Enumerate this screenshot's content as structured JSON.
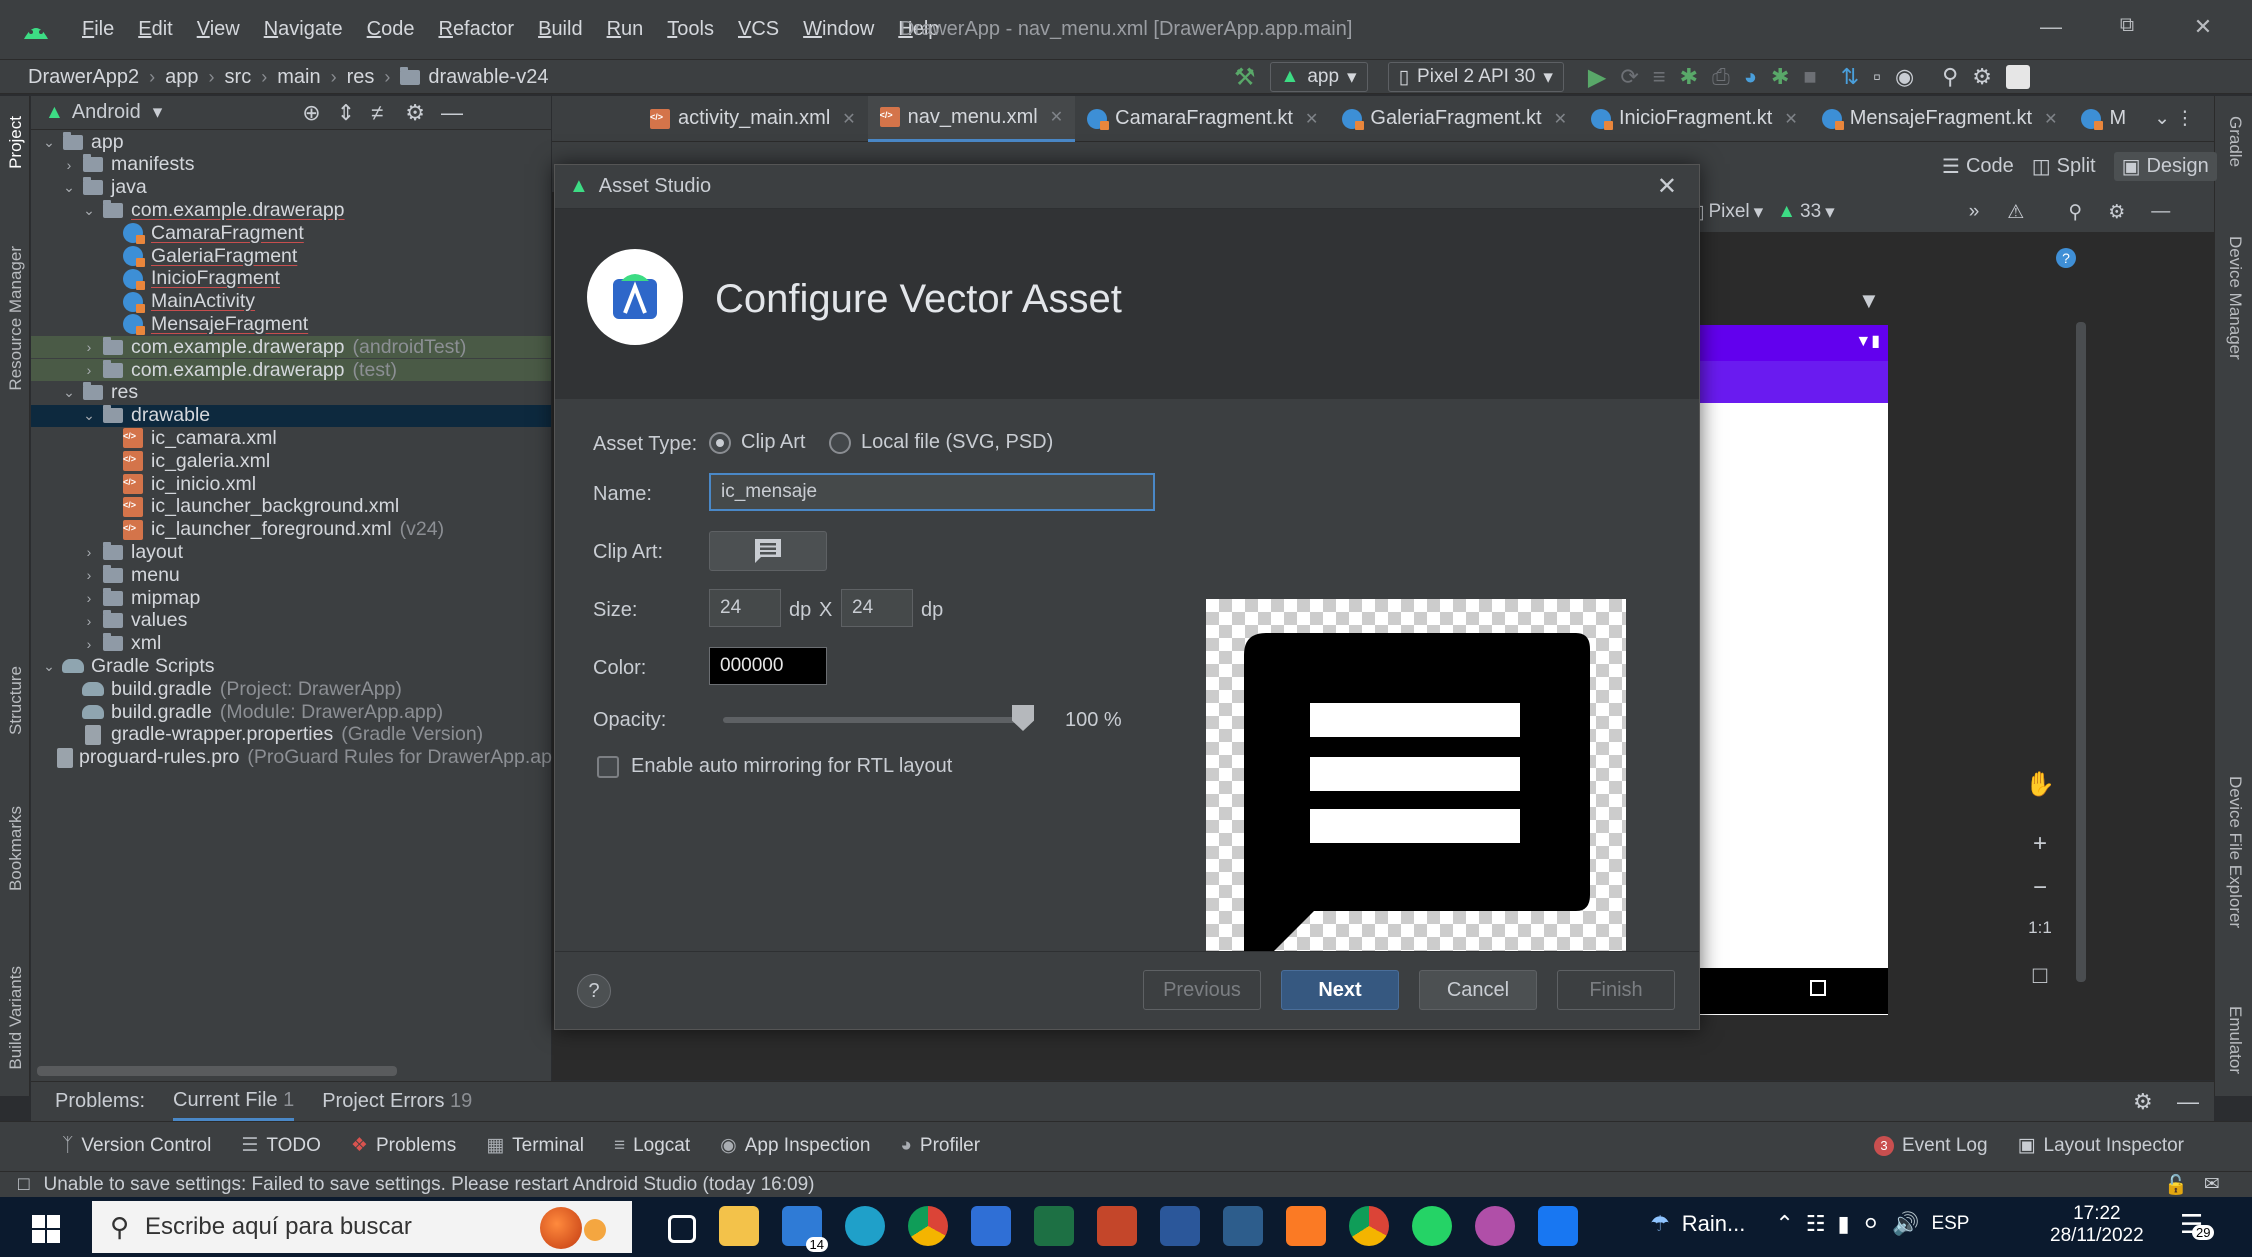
{
  "menu": [
    "File",
    "Edit",
    "View",
    "Navigate",
    "Code",
    "Refactor",
    "Build",
    "Run",
    "Tools",
    "VCS",
    "Window",
    "Help"
  ],
  "window_title": "DrawerApp - nav_menu.xml [DrawerApp.app.main]",
  "breadcrumb": [
    "DrawerApp2",
    "app",
    "src",
    "main",
    "res",
    "drawable-v24"
  ],
  "toolbar": {
    "run_config": "app",
    "device": "Pixel 2 API 30"
  },
  "project_panel": {
    "view_mode": "Android"
  },
  "tree": [
    {
      "label": "app",
      "depth": 0,
      "open": true,
      "icon": "module-icon"
    },
    {
      "label": "manifests",
      "depth": 1,
      "open": false,
      "icon": "folder-icon"
    },
    {
      "label": "java",
      "depth": 1,
      "open": true,
      "icon": "folder-icon"
    },
    {
      "label": "com.example.drawerapp",
      "depth": 2,
      "open": true,
      "icon": "package-icon",
      "link": true
    },
    {
      "label": "CamaraFragment",
      "depth": 3,
      "icon": "kotlin-icon",
      "link": true
    },
    {
      "label": "GaleriaFragment",
      "depth": 3,
      "icon": "kotlin-icon",
      "link": true
    },
    {
      "label": "InicioFragment",
      "depth": 3,
      "icon": "kotlin-icon",
      "link": true
    },
    {
      "label": "MainActivity",
      "depth": 3,
      "icon": "kotlin-icon",
      "link": true
    },
    {
      "label": "MensajeFragment",
      "depth": 3,
      "icon": "kotlin-icon",
      "link": true
    },
    {
      "label": "com.example.drawerapp",
      "hint": "(androidTest)",
      "depth": 2,
      "open": false,
      "icon": "package-icon",
      "shade": true
    },
    {
      "label": "com.example.drawerapp",
      "hint": "(test)",
      "depth": 2,
      "open": false,
      "icon": "package-icon",
      "shade": true
    },
    {
      "label": "res",
      "depth": 1,
      "open": true,
      "icon": "folder-icon"
    },
    {
      "label": "drawable",
      "depth": 2,
      "open": true,
      "icon": "folder-icon",
      "selected": true
    },
    {
      "label": "ic_camara.xml",
      "depth": 3,
      "icon": "xml-icon"
    },
    {
      "label": "ic_galeria.xml",
      "depth": 3,
      "icon": "xml-icon"
    },
    {
      "label": "ic_inicio.xml",
      "depth": 3,
      "icon": "xml-icon"
    },
    {
      "label": "ic_launcher_background.xml",
      "depth": 3,
      "icon": "xml-icon"
    },
    {
      "label": "ic_launcher_foreground.xml",
      "hint": "(v24)",
      "depth": 3,
      "icon": "xml-icon"
    },
    {
      "label": "layout",
      "depth": 2,
      "open": false,
      "icon": "folder-icon"
    },
    {
      "label": "menu",
      "depth": 2,
      "open": false,
      "icon": "folder-icon"
    },
    {
      "label": "mipmap",
      "depth": 2,
      "open": false,
      "icon": "folder-icon"
    },
    {
      "label": "values",
      "depth": 2,
      "open": false,
      "icon": "folder-icon"
    },
    {
      "label": "xml",
      "depth": 2,
      "open": false,
      "icon": "folder-icon"
    },
    {
      "label": "Gradle Scripts",
      "depth": 0,
      "open": true,
      "icon": "gradle-icon"
    },
    {
      "label": "build.gradle",
      "hint": "(Project: DrawerApp)",
      "depth": 1,
      "icon": "gradle-icon"
    },
    {
      "label": "build.gradle",
      "hint": "(Module: DrawerApp.app)",
      "depth": 1,
      "icon": "gradle-icon"
    },
    {
      "label": "gradle-wrapper.properties",
      "hint": "(Gradle Version)",
      "depth": 1,
      "icon": "properties-icon"
    },
    {
      "label": "proguard-rules.pro",
      "hint": "(ProGuard Rules for DrawerApp.app)",
      "depth": 1,
      "icon": "file-icon"
    }
  ],
  "editor_tabs": [
    {
      "label": "activity_main.xml",
      "icon": "xml-icon"
    },
    {
      "label": "nav_menu.xml",
      "icon": "xml-icon",
      "active": true
    },
    {
      "label": "CamaraFragment.kt",
      "icon": "kotlin-icon"
    },
    {
      "label": "GaleriaFragment.kt",
      "icon": "kotlin-icon"
    },
    {
      "label": "InicioFragment.kt",
      "icon": "kotlin-icon"
    },
    {
      "label": "MensajeFragment.kt",
      "icon": "kotlin-icon"
    },
    {
      "label": "M",
      "icon": "kotlin-icon"
    }
  ],
  "view_modes": [
    "Code",
    "Split",
    "Design"
  ],
  "designer": {
    "device": "Pixel",
    "api": "33",
    "zoom_reset": "1:1"
  },
  "dialog": {
    "window_title": "Asset Studio",
    "heading": "Configure Vector Asset",
    "asset_type_label": "Asset Type:",
    "asset_type_options": [
      "Clip Art",
      "Local file (SVG, PSD)"
    ],
    "name_label": "Name:",
    "name_value": "ic_mensaje",
    "clip_art_label": "Clip Art:",
    "size_label": "Size:",
    "size_w": "24",
    "size_h": "24",
    "size_unit": "dp",
    "size_x": "X",
    "color_label": "Color:",
    "color_value": "000000",
    "opacity_label": "Opacity:",
    "opacity_value": "100 %",
    "opacity_level": 1.0,
    "mirror_label": "Enable auto mirroring for RTL layout",
    "help": "?",
    "buttons": {
      "previous": "Previous",
      "next": "Next",
      "cancel": "Cancel",
      "finish": "Finish"
    }
  },
  "problems": {
    "label": "Problems:",
    "tabs": [
      {
        "label": "Current File",
        "count": "1"
      },
      {
        "label": "Project Errors",
        "count": "19"
      }
    ]
  },
  "tool_windows": [
    "Version Control",
    "TODO",
    "Problems",
    "Terminal",
    "Logcat",
    "App Inspection",
    "Profiler"
  ],
  "tool_windows_right": [
    {
      "label": "Event Log",
      "badge": "3"
    },
    {
      "label": "Layout Inspector"
    }
  ],
  "status_message": "Unable to save settings: Failed to save settings. Please restart Android Studio (today 16:09)",
  "left_strip": [
    "Project",
    "Resource Manager",
    "Structure",
    "Bookmarks",
    "Build Variants"
  ],
  "right_strip": [
    "Gradle",
    "Device Manager",
    "Device File Explorer",
    "Emulator"
  ],
  "taskbar": {
    "search_placeholder": "Escribe aquí para buscar",
    "weather": "Rain...",
    "lang": "ESP",
    "time": "17:22",
    "date": "28/11/2022",
    "mail_badge": "14",
    "notif_badge": "29"
  }
}
